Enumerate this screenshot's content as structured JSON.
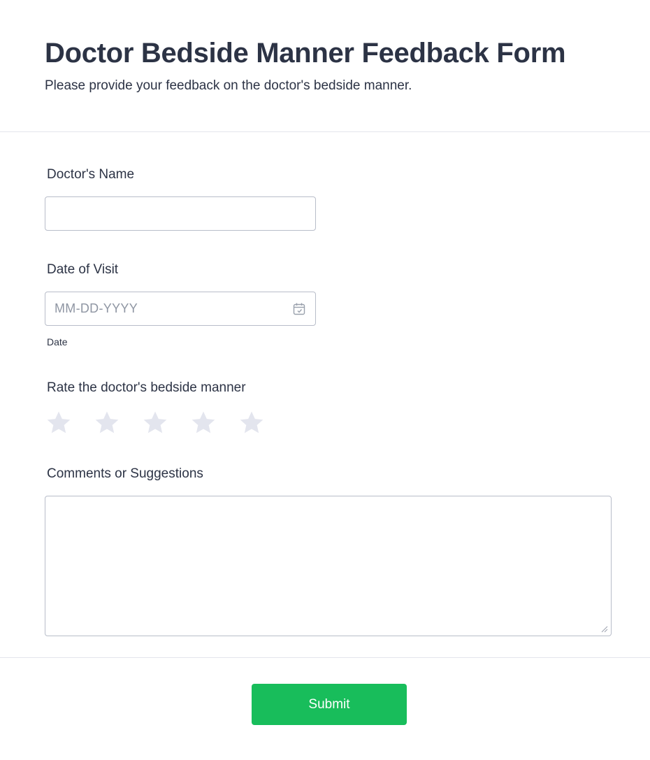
{
  "header": {
    "title": "Doctor Bedside Manner Feedback Form",
    "subtitle": "Please provide your feedback on the doctor's bedside manner."
  },
  "fields": {
    "doctor_name": {
      "label": "Doctor's Name",
      "value": ""
    },
    "date_of_visit": {
      "label": "Date of Visit",
      "placeholder": "MM-DD-YYYY",
      "sublabel": "Date",
      "icon": "calendar-icon"
    },
    "rating": {
      "label": "Rate the doctor's bedside manner",
      "max_stars": 5,
      "selected": 0,
      "star_color": "#e3e5ee",
      "icon": "star-icon"
    },
    "comments": {
      "label": "Comments or Suggestions",
      "value": ""
    }
  },
  "submit": {
    "label": "Submit",
    "color": "#18bd5b"
  }
}
